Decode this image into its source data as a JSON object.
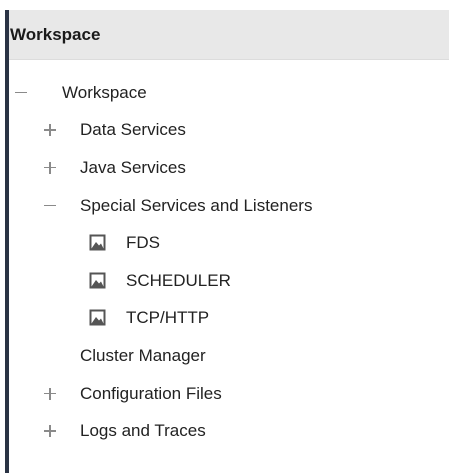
{
  "panel": {
    "header_title": "Workspace"
  },
  "tree": {
    "root": {
      "label": "Workspace",
      "toggle": "collapse"
    },
    "data_services": {
      "label": "Data Services",
      "toggle": "expand"
    },
    "java_services": {
      "label": "Java Services",
      "toggle": "expand"
    },
    "special_services": {
      "label": "Special Services and Listeners",
      "toggle": "collapse"
    },
    "fds": {
      "label": "FDS",
      "icon": "image-icon"
    },
    "scheduler": {
      "label": "SCHEDULER",
      "icon": "image-icon"
    },
    "tcp_http": {
      "label": "TCP/HTTP",
      "icon": "image-icon"
    },
    "cluster_manager": {
      "label": "Cluster Manager"
    },
    "configuration_files": {
      "label": "Configuration Files",
      "toggle": "expand"
    },
    "logs_and_traces": {
      "label": "Logs and Traces",
      "toggle": "expand"
    }
  },
  "colors": {
    "header_bg": "#e8e8e8",
    "left_border": "#2a3344",
    "text": "#222222",
    "toggle": "#8a8a8a",
    "icon": "#555555"
  }
}
